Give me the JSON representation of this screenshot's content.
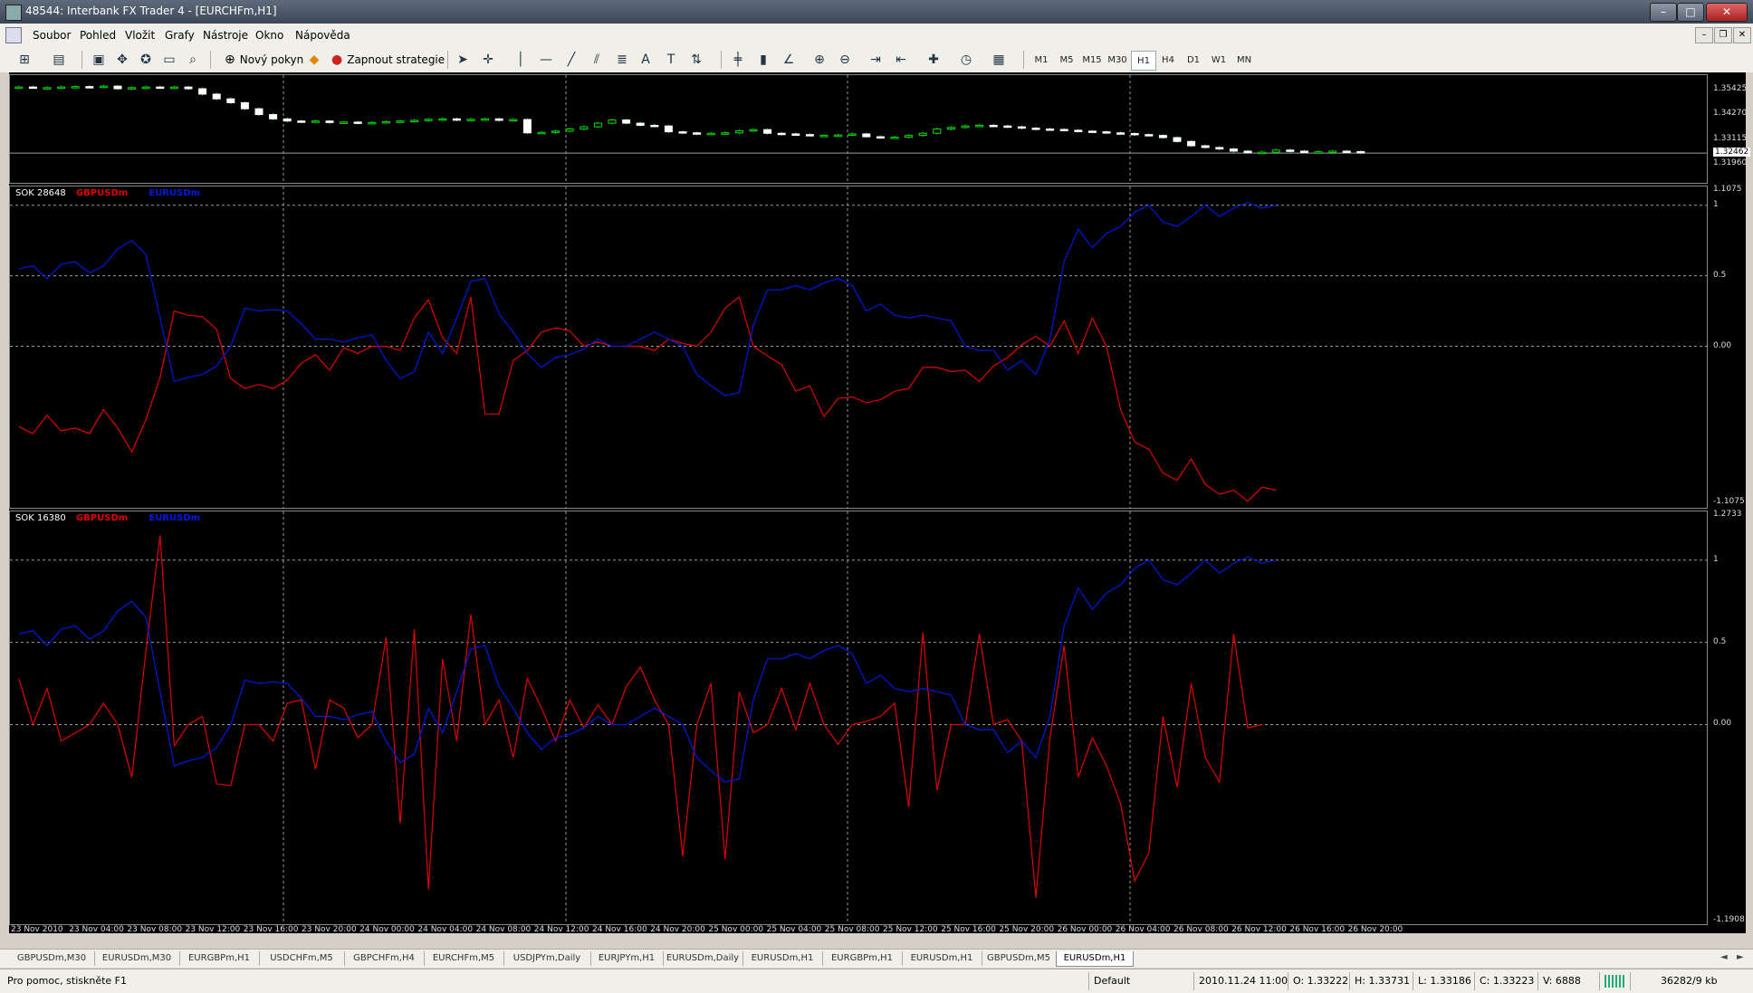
{
  "window": {
    "title": "48544: Interbank FX Trader 4 - [EURCHFm,H1]",
    "buttons": {
      "minimize": "–",
      "maximize": "□",
      "close": "✕"
    }
  },
  "menu": {
    "items": [
      "Soubor",
      "Pohled",
      "Vložit",
      "Grafy",
      "Nástroje",
      "Okno",
      "Nápověda"
    ],
    "mdi_buttons": [
      "–",
      "❐",
      "✕"
    ]
  },
  "toolbar": {
    "new_order_label": "Nový pokyn",
    "strategies_label": "Zapnout strategie",
    "timeframes": [
      "M1",
      "M5",
      "M15",
      "M30",
      "H1",
      "H4",
      "D1",
      "W1",
      "MN"
    ],
    "active_timeframe": "H1"
  },
  "chart_data": {
    "type": "line",
    "symbol": "EURCHFm,H1",
    "x_tick_labels": [
      "23 Nov 2010",
      "23 Nov 04:00",
      "23 Nov 08:00",
      "23 Nov 12:00",
      "23 Nov 16:00",
      "23 Nov 20:00",
      "24 Nov 00:00",
      "24 Nov 04:00",
      "24 Nov 08:00",
      "24 Nov 12:00",
      "24 Nov 16:00",
      "24 Nov 20:00",
      "25 Nov 00:00",
      "25 Nov 04:00",
      "25 Nov 08:00",
      "25 Nov 12:00",
      "25 Nov 16:00",
      "25 Nov 20:00",
      "26 Nov 00:00",
      "26 Nov 04:00",
      "26 Nov 08:00",
      "26 Nov 12:00",
      "26 Nov 16:00",
      "26 Nov 20:00"
    ],
    "panes": [
      {
        "name": "main",
        "type": "candlestick",
        "y_ticks": [
          "1.35425",
          "1.34270",
          "1.33115",
          "1.31960"
        ],
        "current_price": "1.32462",
        "ylim": [
          1.3196,
          1.3583
        ],
        "close_series": [
          1.3553,
          1.355,
          1.355,
          1.3553,
          1.3555,
          1.3553,
          1.3557,
          1.3545,
          1.355,
          1.3553,
          1.355,
          1.3553,
          1.3545,
          1.352,
          1.3498,
          1.348,
          1.3452,
          1.3425,
          1.3405,
          1.3395,
          1.3392,
          1.3395,
          1.3388,
          1.339,
          1.3385,
          1.3388,
          1.3392,
          1.3395,
          1.3398,
          1.3403,
          1.3405,
          1.34,
          1.3403,
          1.3405,
          1.3398,
          1.3402,
          1.334,
          1.3342,
          1.3348,
          1.3358,
          1.3368,
          1.3385,
          1.34,
          1.3385,
          1.3375,
          1.3372,
          1.3345,
          1.334,
          1.3335,
          1.3338,
          1.334,
          1.335,
          1.3355,
          1.3338,
          1.3335,
          1.3332,
          1.3328,
          1.3328,
          1.333,
          1.3335,
          1.3322,
          1.3318,
          1.332,
          1.3328,
          1.3338,
          1.3358,
          1.3365,
          1.3372,
          1.3375,
          1.3372,
          1.3368,
          1.3362,
          1.3358,
          1.3356,
          1.3352,
          1.3348,
          1.3345,
          1.334,
          1.3337,
          1.3332,
          1.3328,
          1.3318,
          1.33,
          1.328,
          1.3272,
          1.3265,
          1.3255,
          1.3248,
          1.325,
          1.326,
          1.3255,
          1.325,
          1.3252,
          1.3255,
          1.3253,
          1.3248
        ]
      },
      {
        "name": "SOK 28648",
        "ylim": [
          -1.1075,
          1.1075
        ],
        "y_ticks": [
          "1.1075",
          "1",
          "0.5",
          "0.00",
          "-1.1075"
        ],
        "series": [
          {
            "name": "GBPUSDm",
            "color": "#e00000",
            "values": [
              -0.57,
              -0.62,
              -0.49,
              -0.6,
              -0.58,
              -0.62,
              -0.45,
              -0.58,
              -0.75,
              -0.52,
              -0.22,
              0.25,
              0.22,
              0.21,
              0.12,
              -0.23,
              -0.3,
              -0.27,
              -0.3,
              -0.24,
              -0.12,
              -0.06,
              -0.17,
              -0.01,
              -0.05,
              0.0,
              0.0,
              -0.03,
              0.2,
              0.33,
              0.06,
              -0.05,
              0.35,
              -0.48,
              -0.48,
              -0.1,
              -0.03,
              0.1,
              0.13,
              0.11,
              0.0,
              0.03,
              0.0,
              0.0,
              0.0,
              -0.03,
              0.05,
              0.02,
              0.0,
              0.1,
              0.27,
              0.35,
              0.0,
              -0.07,
              -0.13,
              -0.32,
              -0.28,
              -0.5,
              -0.37,
              -0.36,
              -0.4,
              -0.38,
              -0.32,
              -0.3,
              -0.15,
              -0.15,
              -0.18,
              -0.17,
              -0.25,
              -0.14,
              -0.08,
              0.01,
              0.07,
              0.0,
              0.18,
              -0.05,
              0.2,
              0.0,
              -0.45,
              -0.68,
              -0.73,
              -0.9,
              -0.95,
              -0.8,
              -0.98,
              -1.05,
              -1.02,
              -1.1,
              -1.0,
              -1.02
            ]
          },
          {
            "name": "EURUSDm",
            "color": "#0018e0",
            "values": [
              0.55,
              0.57,
              0.48,
              0.58,
              0.6,
              0.52,
              0.57,
              0.69,
              0.75,
              0.65,
              0.2,
              -0.25,
              -0.22,
              -0.2,
              -0.14,
              0.0,
              0.27,
              0.25,
              0.26,
              0.25,
              0.16,
              0.05,
              0.05,
              0.03,
              0.06,
              0.08,
              -0.1,
              -0.23,
              -0.18,
              0.1,
              -0.05,
              0.2,
              0.46,
              0.48,
              0.23,
              0.1,
              -0.05,
              -0.15,
              -0.08,
              -0.06,
              -0.02,
              0.05,
              0.0,
              0.0,
              0.05,
              0.1,
              0.05,
              0.0,
              -0.2,
              -0.28,
              -0.35,
              -0.33,
              0.15,
              0.4,
              0.4,
              0.43,
              0.4,
              0.45,
              0.48,
              0.43,
              0.25,
              0.3,
              0.22,
              0.2,
              0.22,
              0.2,
              0.18,
              0.0,
              -0.03,
              -0.03,
              -0.17,
              -0.1,
              -0.2,
              0.05,
              0.6,
              0.83,
              0.7,
              0.8,
              0.85,
              0.95,
              1.0,
              0.88,
              0.85,
              0.92,
              1.0,
              0.92,
              0.98,
              1.02,
              0.98,
              1.0
            ]
          }
        ]
      },
      {
        "name": "SOK 16380",
        "ylim": [
          -1.1908,
          1.2733
        ],
        "y_ticks": [
          "1.2733",
          "1",
          "0.5",
          "0.00",
          "-1.1908"
        ],
        "series": [
          {
            "name": "GBPUSDm",
            "color": "#e00000",
            "values": [
              0.28,
              0.0,
              0.22,
              -0.1,
              -0.05,
              0.0,
              0.13,
              0.0,
              -0.32,
              0.45,
              1.15,
              -0.13,
              0.0,
              0.05,
              -0.36,
              -0.37,
              0.0,
              0.0,
              -0.1,
              0.13,
              0.15,
              -0.27,
              0.15,
              0.1,
              -0.08,
              0.0,
              0.53,
              -0.6,
              0.58,
              -1.0,
              0.4,
              -0.1,
              0.67,
              0.0,
              0.15,
              -0.2,
              0.28,
              0.1,
              -0.1,
              0.15,
              -0.02,
              0.12,
              0.0,
              0.23,
              0.35,
              0.15,
              0.0,
              -0.8,
              0.0,
              0.25,
              -0.82,
              0.2,
              -0.05,
              0.0,
              0.22,
              -0.03,
              0.25,
              0.0,
              -0.12,
              0.0,
              0.02,
              0.05,
              0.13,
              -0.5,
              0.56,
              -0.4,
              0.0,
              0.0,
              0.55,
              0.0,
              0.03,
              -0.1,
              -1.05,
              -0.08,
              0.48,
              -0.32,
              -0.08,
              -0.25,
              -0.48,
              -0.95,
              -0.78,
              0.05,
              -0.38,
              0.25,
              -0.2,
              -0.35,
              0.55,
              -0.02,
              0.0
            ]
          },
          {
            "name": "EURUSDm",
            "color": "#0018e0",
            "values": [
              0.55,
              0.57,
              0.48,
              0.58,
              0.6,
              0.52,
              0.57,
              0.69,
              0.75,
              0.65,
              0.2,
              -0.25,
              -0.22,
              -0.2,
              -0.14,
              0.0,
              0.27,
              0.25,
              0.26,
              0.25,
              0.16,
              0.05,
              0.05,
              0.03,
              0.06,
              0.08,
              -0.1,
              -0.23,
              -0.18,
              0.1,
              -0.05,
              0.2,
              0.46,
              0.48,
              0.23,
              0.1,
              -0.05,
              -0.15,
              -0.08,
              -0.06,
              -0.02,
              0.05,
              0.0,
              0.0,
              0.05,
              0.1,
              0.05,
              0.0,
              -0.2,
              -0.28,
              -0.35,
              -0.33,
              0.15,
              0.4,
              0.4,
              0.43,
              0.4,
              0.45,
              0.48,
              0.43,
              0.25,
              0.3,
              0.22,
              0.2,
              0.22,
              0.2,
              0.18,
              0.0,
              -0.03,
              -0.03,
              -0.17,
              -0.1,
              -0.2,
              0.05,
              0.6,
              0.83,
              0.7,
              0.8,
              0.85,
              0.95,
              1.0,
              0.88,
              0.85,
              0.92,
              1.0,
              0.92,
              0.98,
              1.02,
              0.98,
              1.0
            ]
          }
        ]
      }
    ],
    "grid": true,
    "background": "#000000",
    "candle_color": "#00e000"
  },
  "tabs": {
    "items": [
      "GBPUSDm,M30",
      "EURUSDm,M30",
      "EURGBPm,H1",
      "USDCHFm,M5",
      "GBPCHFm,H4",
      "EURCHFm,M5",
      "USDJPYm,Daily",
      "EURJPYm,H1",
      "EURUSDm,Daily",
      "EURUSDm,H1",
      "EURGBPm,H1",
      "EURUSDm,H1",
      "GBPUSDm,M5",
      "EURUSDm,H1"
    ],
    "active_index": 13,
    "nav": [
      "◄",
      "►"
    ]
  },
  "status": {
    "help": "Pro pomoc, stiskněte F1",
    "profile": "Default",
    "datetime": "2010.11.24 11:00",
    "open": "O: 1.33222",
    "high": "H: 1.33731",
    "low": "L: 1.33186",
    "close": "C: 1.33223",
    "volume": "V: 6888",
    "traffic": "36282/9 kb"
  }
}
